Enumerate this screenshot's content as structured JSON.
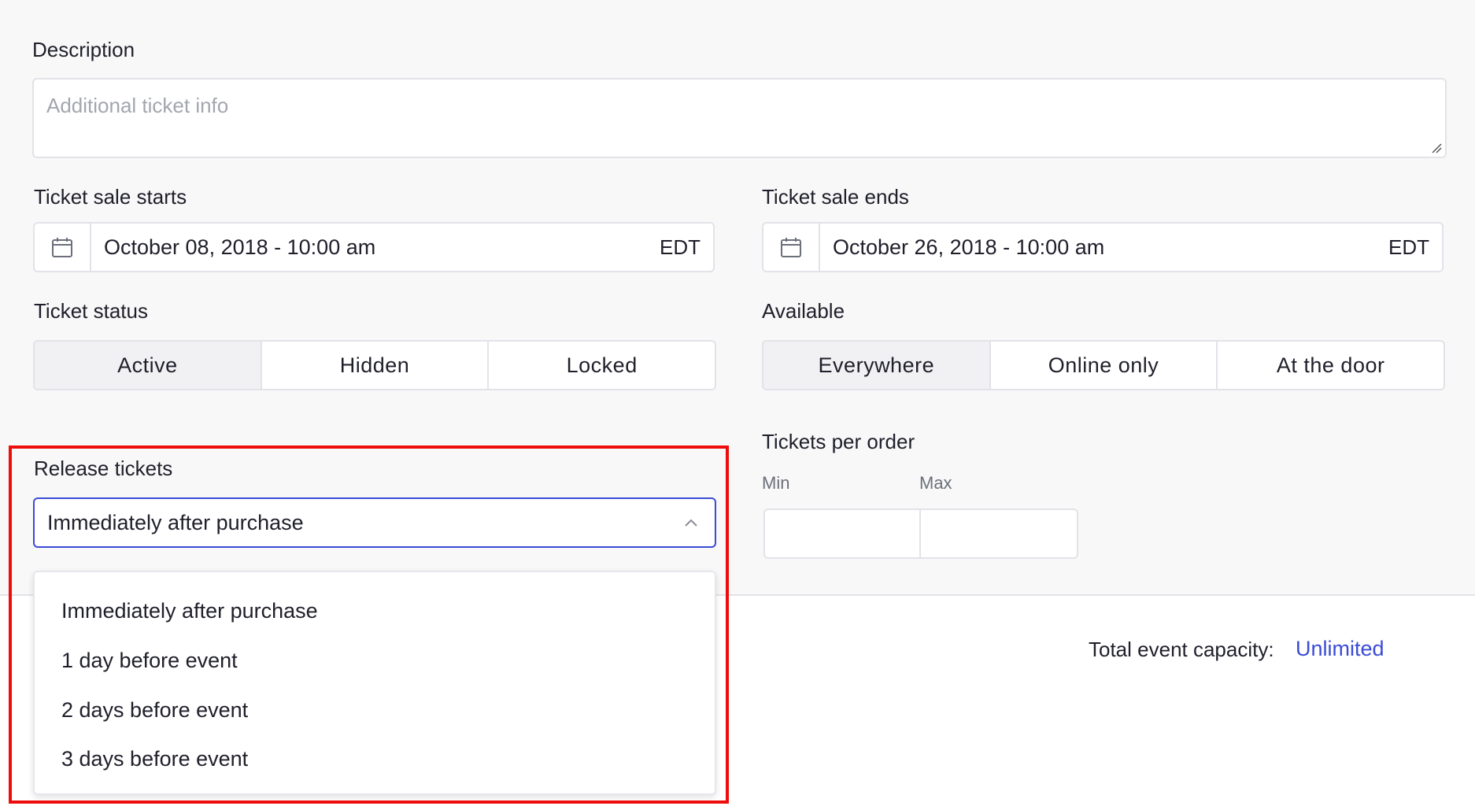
{
  "description": {
    "label": "Description",
    "placeholder": "Additional ticket info",
    "resize_icon": "resize-grip-icon"
  },
  "sale_starts": {
    "label": "Ticket sale starts",
    "value": "October 08, 2018 - 10:00 am",
    "timezone": "EDT",
    "icon": "calendar-icon"
  },
  "sale_ends": {
    "label": "Ticket sale ends",
    "value": "October 26, 2018 - 10:00 am",
    "timezone": "EDT",
    "icon": "calendar-icon"
  },
  "ticket_status": {
    "label": "Ticket status",
    "options": [
      "Active",
      "Hidden",
      "Locked"
    ],
    "selected": "Active"
  },
  "available": {
    "label": "Available",
    "options": [
      "Everywhere",
      "Online only",
      "At the door"
    ],
    "selected": "Everywhere"
  },
  "release_tickets": {
    "label": "Release tickets",
    "selected": "Immediately after purchase",
    "icon": "chevron-up-icon",
    "options": [
      "Immediately after purchase",
      "1 day before event",
      "2 days before event",
      "3 days before event"
    ]
  },
  "tickets_per_order": {
    "label": "Tickets per order",
    "min_label": "Min",
    "max_label": "Max",
    "min_value": "",
    "max_value": ""
  },
  "capacity": {
    "label": "Total event capacity:",
    "value": "Unlimited"
  },
  "colors": {
    "accent": "#3a4bd6",
    "highlight": "#ee0d0d",
    "border": "#e2e3e8",
    "selected_segment": "#f1f1f3"
  }
}
